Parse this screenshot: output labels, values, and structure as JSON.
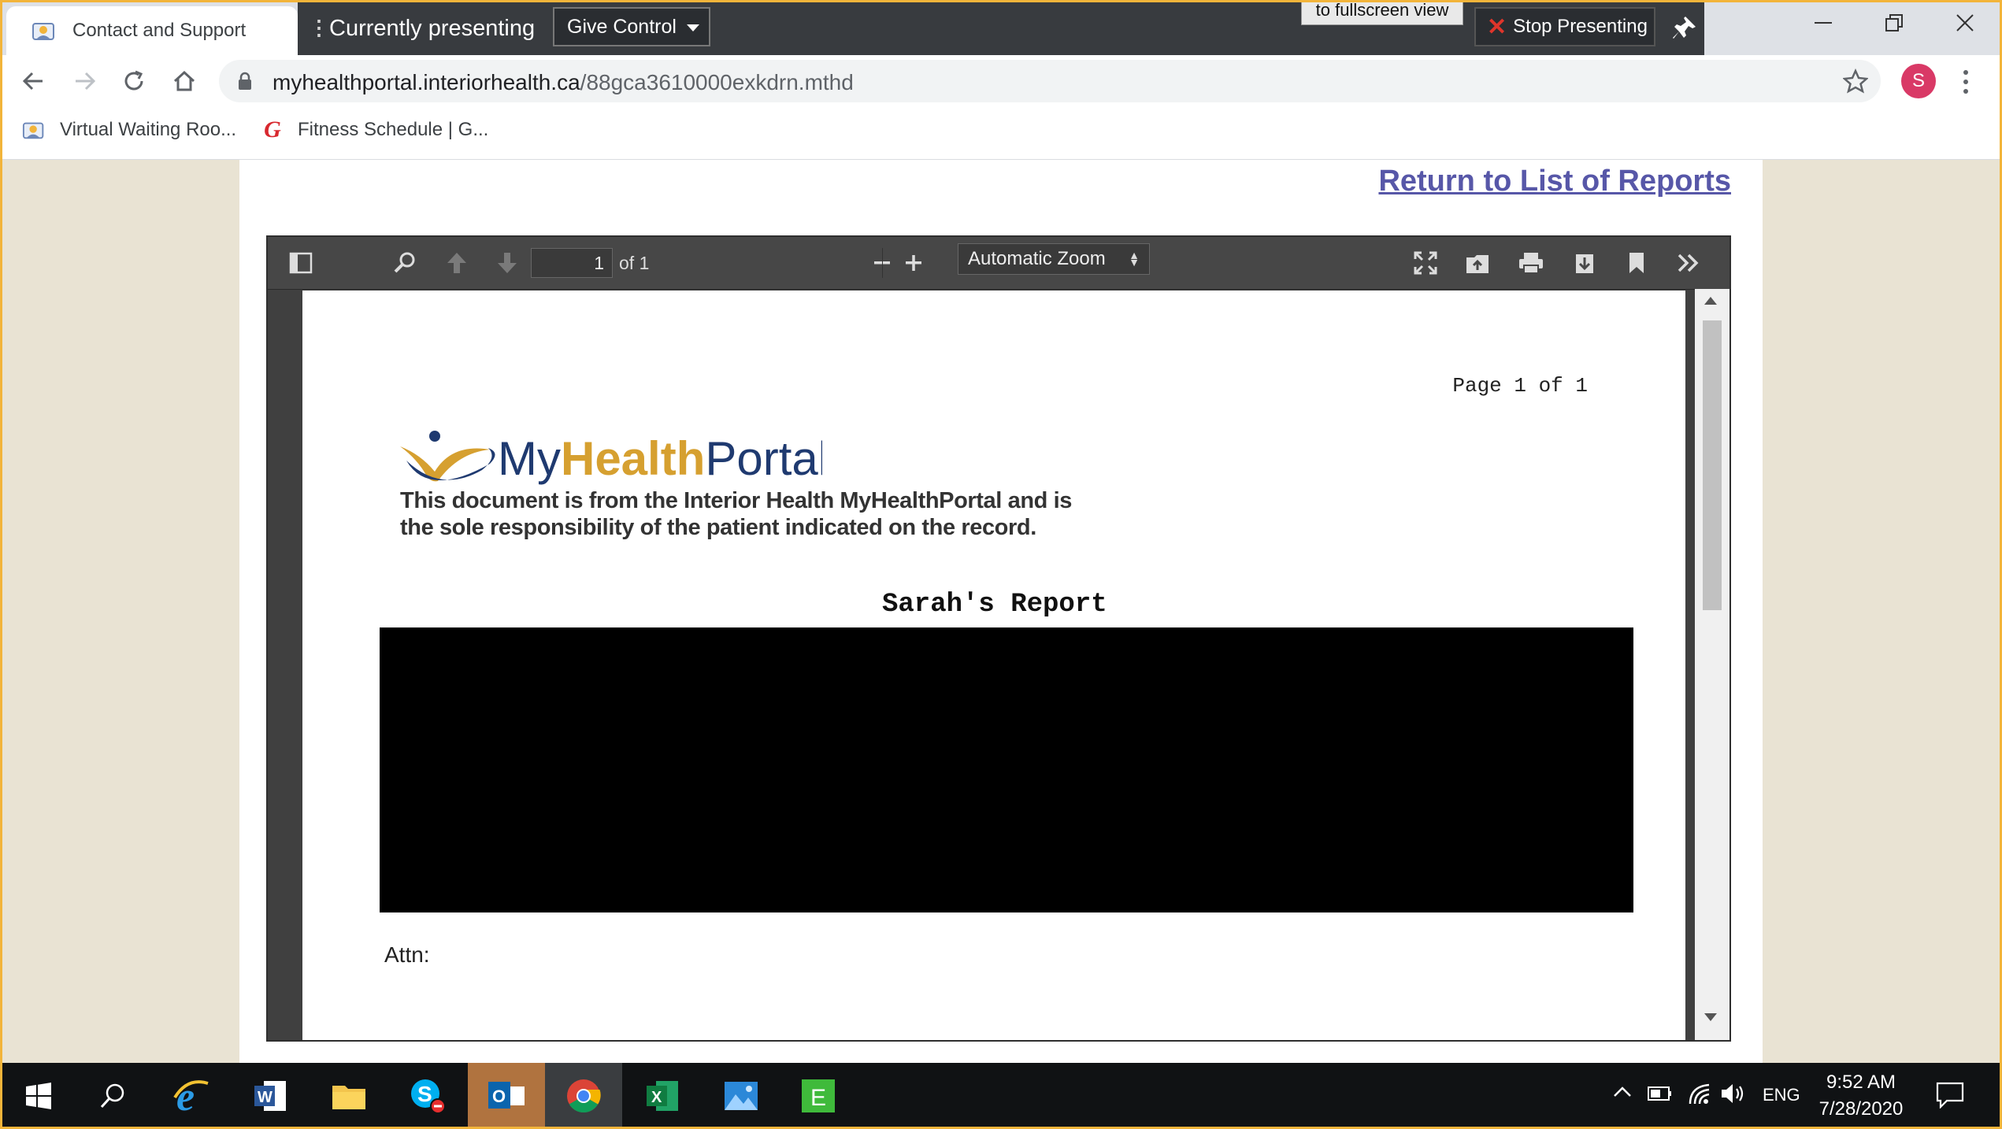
{
  "browser": {
    "tab": {
      "title": "Contact and Support"
    },
    "address": {
      "domain": "myhealthportal.interiorhealth.ca",
      "path": "/88gca3610000exkdrn.mthd"
    },
    "profile_initial": "S",
    "bookmarks": [
      {
        "label": "Virtual Waiting Roo...",
        "icon": "video-call-icon"
      },
      {
        "label": "Fitness Schedule | G...",
        "icon": "g-logo-icon"
      }
    ]
  },
  "presenting": {
    "label": "Currently presenting",
    "give_control": "Give Control",
    "fullscreen_tip": "to fullscreen view",
    "stop": "Stop Presenting"
  },
  "page": {
    "return_link": "Return to List of Reports"
  },
  "pdf_viewer": {
    "page_number": "1",
    "page_total": "of 1",
    "zoom": "Automatic Zoom"
  },
  "document": {
    "page_count": "Page 1 of 1",
    "logo": {
      "my": "My",
      "health": "Health",
      "portal": "Portal"
    },
    "disclaimer_line1": "This document is from the Interior Health MyHealthPortal and is",
    "disclaimer_line2": "the sole responsibility of the patient indicated on the record.",
    "title": "Sarah's Report",
    "attn": "Attn:"
  },
  "taskbar": {
    "language": "ENG",
    "time": "9:52 AM",
    "date": "7/28/2020"
  },
  "colors": {
    "accent_orange": "#f2b43a",
    "link": "#5757a8",
    "logo_navy": "#1f3a70",
    "logo_gold": "#d6a030"
  }
}
